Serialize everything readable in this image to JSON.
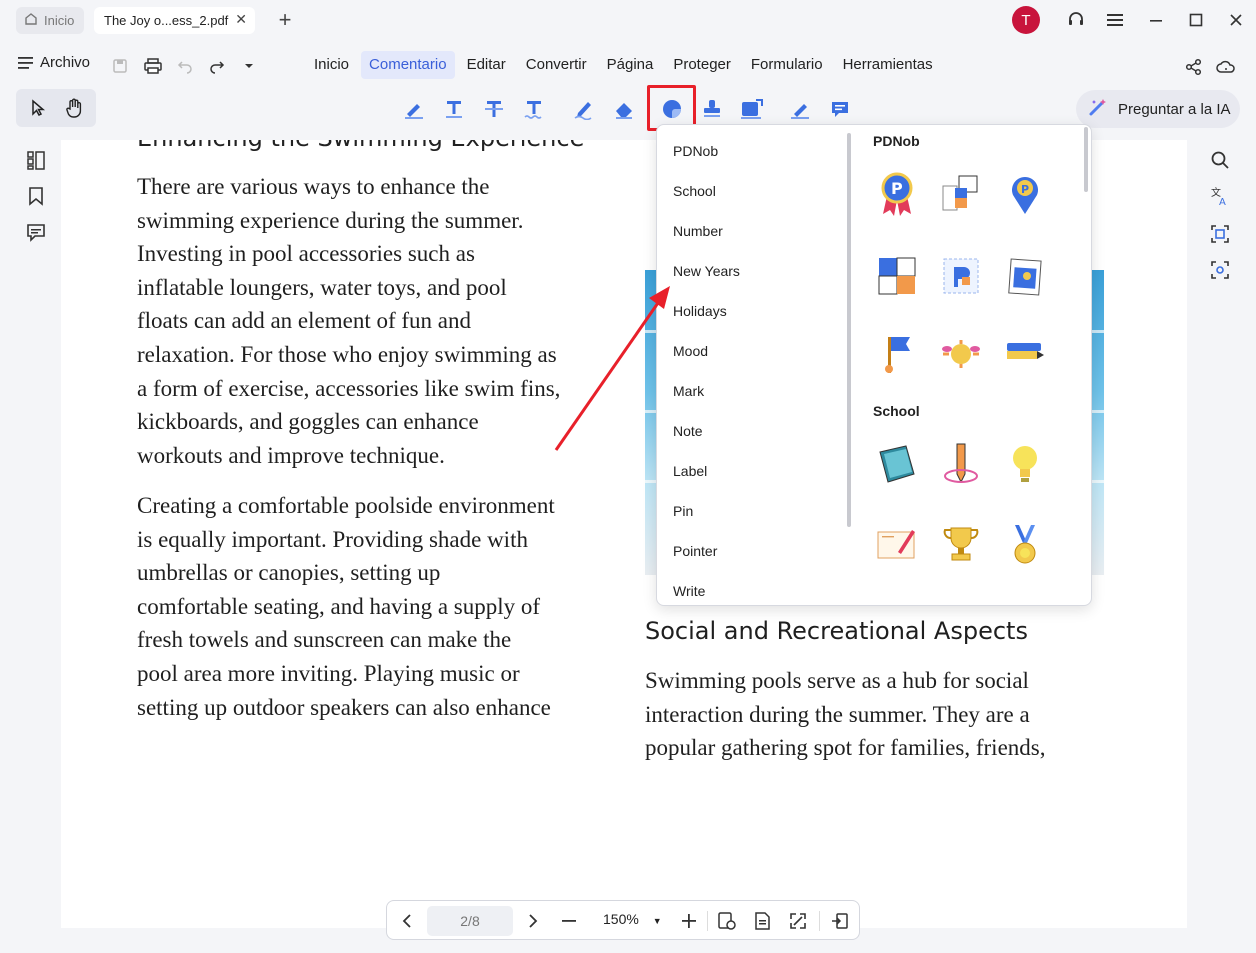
{
  "tabs": {
    "home_label": "Inicio",
    "doc_label": "The Joy o...ess_2.pdf"
  },
  "user": {
    "initial": "T",
    "color": "#c8143c"
  },
  "menubar": {
    "file_label": "Archivo",
    "items": [
      "Inicio",
      "Comentario",
      "Editar",
      "Convertir",
      "Página",
      "Proteger",
      "Formulario",
      "Herramientas"
    ],
    "active": "Comentario"
  },
  "toolbar": {
    "ask_ai_label": "Preguntar a la IA",
    "tools": [
      "highlight-icon",
      "text-underline-icon",
      "strikethrough-icon",
      "squiggly-icon",
      "pen-icon",
      "eraser-icon",
      "sticker-icon",
      "stamp-icon",
      "shape-icon",
      "signature-icon",
      "comment-icon"
    ]
  },
  "document": {
    "left_heading": "Enhancing the Swimming Experience",
    "left_p1": "There are various ways to enhance the\nswimming experience during the summer.\nInvesting in pool accessories such as\ninflatable loungers, water toys, and pool\nfloats can add an element of fun and\nrelaxation. For those who enjoy swimming as\na form of exercise, accessories like swim fins,\nkickboards, and goggles can enhance\nworkouts and improve technique.",
    "left_p2": "Creating a comfortable poolside environment\nis equally important. Providing shade with\numbrellas or canopies, setting up\ncomfortable seating, and having a supply of\nfresh towels and sunscreen can make the\npool area more inviting. Playing music or\nsetting up outdoor speakers can also enhance",
    "right_heading": "Social and Recreational Aspects",
    "right_p1": "Swimming pools serve as a hub for social\ninteraction during the summer. They are a\npopular gathering spot for families, friends,"
  },
  "stickers": {
    "categories": [
      "PDNob",
      "School",
      "Number",
      "New Years",
      "Holidays",
      "Mood",
      "Mark",
      "Note",
      "Label",
      "Pin",
      "Pointer",
      "Write"
    ],
    "sections": [
      {
        "title": "PDNob",
        "items": [
          "badge-ribbon-sticker",
          "pdnob-logo-blocks-sticker",
          "map-pin-sticker",
          "puzzle-sticker",
          "pdnob-frame-sticker",
          "photo-card-sticker",
          "flag-sticker",
          "sun-mood-sticker",
          "do-this-pencil-sticker"
        ]
      },
      {
        "title": "School",
        "items": [
          "book-sticker",
          "study-time-pencil-sticker",
          "lightbulb-sticker",
          "notebook-pencil-sticker",
          "trophy-sticker",
          "medal-sticker"
        ]
      }
    ]
  },
  "navigation": {
    "page_indicator": "2/8",
    "zoom_level": "150%"
  },
  "colors": {
    "accent": "#3a5fd9",
    "highlight_box": "#e8202a",
    "arrow": "#e8202a"
  }
}
